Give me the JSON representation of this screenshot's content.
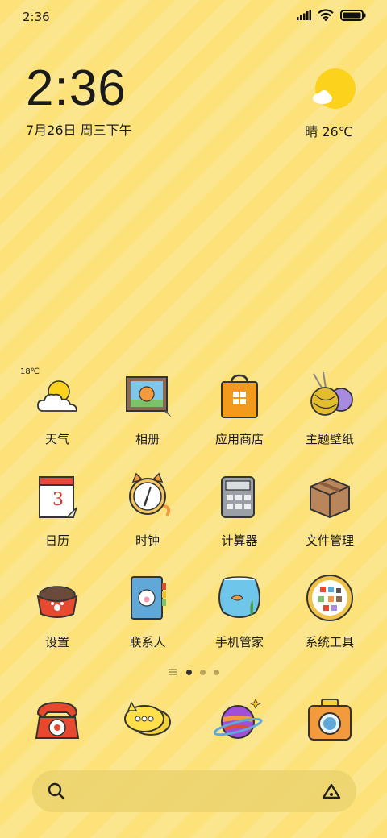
{
  "status_bar": {
    "time": "2:36",
    "icons": [
      "signal-icon",
      "wifi-icon",
      "battery-icon"
    ]
  },
  "clock": {
    "time": "2:36",
    "date": "7月26日 周三下午"
  },
  "weather": {
    "text": "晴 26℃",
    "icon": "sun-cloud-icon"
  },
  "apps": [
    {
      "label": "天气",
      "icon": "weather-icon",
      "badge": "18℃"
    },
    {
      "label": "相册",
      "icon": "gallery-icon"
    },
    {
      "label": "应用商店",
      "icon": "app-store-icon"
    },
    {
      "label": "主题壁纸",
      "icon": "yarn-icon"
    },
    {
      "label": "日历",
      "icon": "calendar-icon",
      "calendar_day": "3"
    },
    {
      "label": "时钟",
      "icon": "cat-clock-icon"
    },
    {
      "label": "计算器",
      "icon": "calculator-icon"
    },
    {
      "label": "文件管理",
      "icon": "box-icon"
    },
    {
      "label": "设置",
      "icon": "pet-bowl-icon"
    },
    {
      "label": "联系人",
      "icon": "notebook-icon"
    },
    {
      "label": "手机管家",
      "icon": "fishbowl-icon"
    },
    {
      "label": "系统工具",
      "icon": "tools-icon"
    }
  ],
  "page_indicator": {
    "pages": 3,
    "active": 0
  },
  "dock": [
    {
      "name": "phone",
      "icon": "phone-icon"
    },
    {
      "name": "messages",
      "icon": "chat-bubble-icon"
    },
    {
      "name": "browser",
      "icon": "planet-icon"
    },
    {
      "name": "camera",
      "icon": "camera-icon"
    }
  ],
  "search": {
    "icon": "search-icon",
    "assistant_icon": "assistant-icon"
  }
}
